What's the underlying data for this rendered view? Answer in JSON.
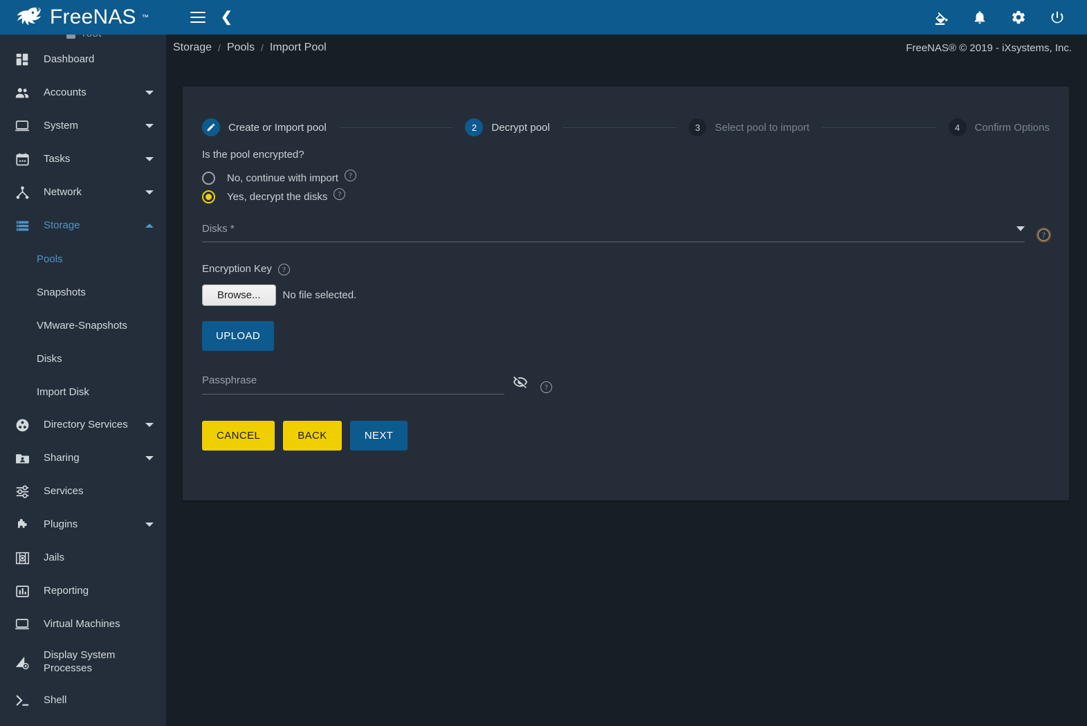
{
  "brand": {
    "name": "FreeNAS",
    "tm": "™"
  },
  "topbar": {
    "menu_toggle": "menu-icon",
    "collapse": "chevron-left-icon",
    "icons": [
      {
        "name": "theme-fill-icon",
        "label": "Change Theme"
      },
      {
        "name": "notifications-bell-icon",
        "label": "Notifications"
      },
      {
        "name": "settings-gear-icon",
        "label": "Settings"
      },
      {
        "name": "power-icon",
        "label": "Power"
      }
    ]
  },
  "sidebar": {
    "user": "root",
    "items": [
      {
        "label": "Dashboard",
        "icon": "dashboard-icon",
        "expandable": false,
        "active": false
      },
      {
        "label": "Accounts",
        "icon": "accounts-icon",
        "expandable": true,
        "active": false
      },
      {
        "label": "System",
        "icon": "system-icon",
        "expandable": true,
        "active": false
      },
      {
        "label": "Tasks",
        "icon": "tasks-calendar-icon",
        "expandable": true,
        "active": false
      },
      {
        "label": "Network",
        "icon": "network-icon",
        "expandable": true,
        "active": false
      },
      {
        "label": "Storage",
        "icon": "storage-icon",
        "expandable": true,
        "active": true,
        "expanded": true
      },
      {
        "label": "Directory Services",
        "icon": "directory-services-icon",
        "expandable": true,
        "active": false
      },
      {
        "label": "Sharing",
        "icon": "sharing-folder-icon",
        "expandable": true,
        "active": false
      },
      {
        "label": "Services",
        "icon": "services-sliders-icon",
        "expandable": false,
        "active": false
      },
      {
        "label": "Plugins",
        "icon": "plugins-puzzle-icon",
        "expandable": true,
        "active": false
      },
      {
        "label": "Jails",
        "icon": "jails-icon",
        "expandable": false,
        "active": false
      },
      {
        "label": "Reporting",
        "icon": "reporting-chart-icon",
        "expandable": false,
        "active": false
      },
      {
        "label": "Virtual Machines",
        "icon": "virtual-machines-icon",
        "expandable": false,
        "active": false
      },
      {
        "label": "Display System Processes",
        "icon": "display-system-processes-icon",
        "expandable": false,
        "active": false
      },
      {
        "label": "Shell",
        "icon": "shell-prompt-icon",
        "expandable": false,
        "active": false
      }
    ],
    "storage_children": [
      {
        "label": "Pools",
        "active": true
      },
      {
        "label": "Snapshots",
        "active": false
      },
      {
        "label": "VMware-Snapshots",
        "active": false
      },
      {
        "label": "Disks",
        "active": false
      },
      {
        "label": "Import Disk",
        "active": false
      }
    ]
  },
  "breadcrumb": {
    "items": [
      "Storage",
      "Pools",
      "Import Pool"
    ],
    "separator": "/"
  },
  "copyright": "FreeNAS® © 2019 - iXsystems, Inc.",
  "wizard": {
    "steps": [
      {
        "num": "1",
        "label": "Create or Import pool",
        "state": "done"
      },
      {
        "num": "2",
        "label": "Decrypt pool",
        "state": "current"
      },
      {
        "num": "3",
        "label": "Select pool to import",
        "state": "todo"
      },
      {
        "num": "4",
        "label": "Confirm Options",
        "state": "todo"
      }
    ]
  },
  "form": {
    "question": "Is the pool encrypted?",
    "options": [
      {
        "label": "No, continue with import",
        "selected": false
      },
      {
        "label": "Yes, decrypt the disks",
        "selected": true
      }
    ],
    "help_glyph": "?",
    "disks": {
      "label": "Disks *",
      "value": "",
      "placeholder": "Disks *"
    },
    "encryption_key": {
      "label": "Encryption Key",
      "browse_label": "Browse...",
      "file_status": "No file selected.",
      "upload_label": "UPLOAD"
    },
    "passphrase": {
      "label": "Passphrase",
      "value": "",
      "placeholder": "Passphrase"
    },
    "buttons": {
      "cancel": "CANCEL",
      "back": "BACK",
      "next": "NEXT"
    }
  },
  "colors": {
    "brand_blue": "#0d5a8f",
    "accent_yellow": "#f0cf00",
    "sidebar_bg": "#242e3a",
    "card_bg": "#252e38",
    "page_bg": "#171e26",
    "active_link": "#4e94c8"
  }
}
